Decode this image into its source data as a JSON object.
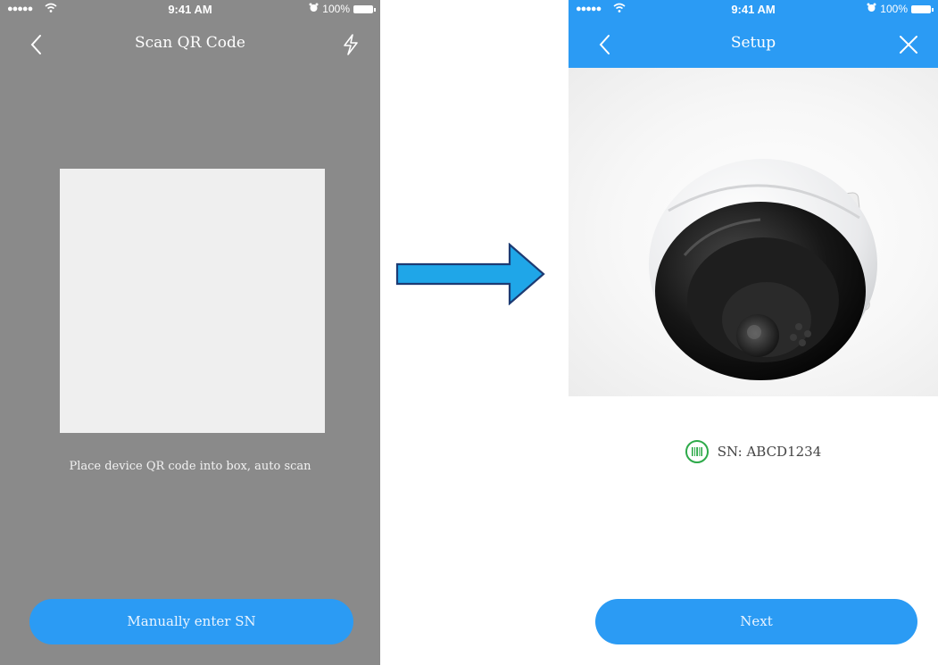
{
  "left_screen": {
    "status": {
      "signal": "●●●●●",
      "time": "9:41 AM",
      "battery": "100%"
    },
    "title": "Scan QR Code",
    "hint": "Place device QR code into box, auto scan",
    "manual_button": "Manually enter SN"
  },
  "right_screen": {
    "status": {
      "signal": "●●●●●",
      "time": "9:41 AM",
      "battery": "100%"
    },
    "title": "Setup",
    "sn_text": "SN: ABCD1234",
    "next_button": "Next"
  },
  "colors": {
    "accent_blue": "#2b9bf4",
    "overlay_gray": "#8a8a8a",
    "sn_green": "#2eaa4a",
    "arrow_fill": "#1fa6e8",
    "arrow_stroke": "#1d3b73"
  },
  "icons": [
    "back-chevron-icon",
    "flash-icon",
    "close-icon",
    "barcode-icon",
    "wifi-icon",
    "alarm-icon"
  ]
}
